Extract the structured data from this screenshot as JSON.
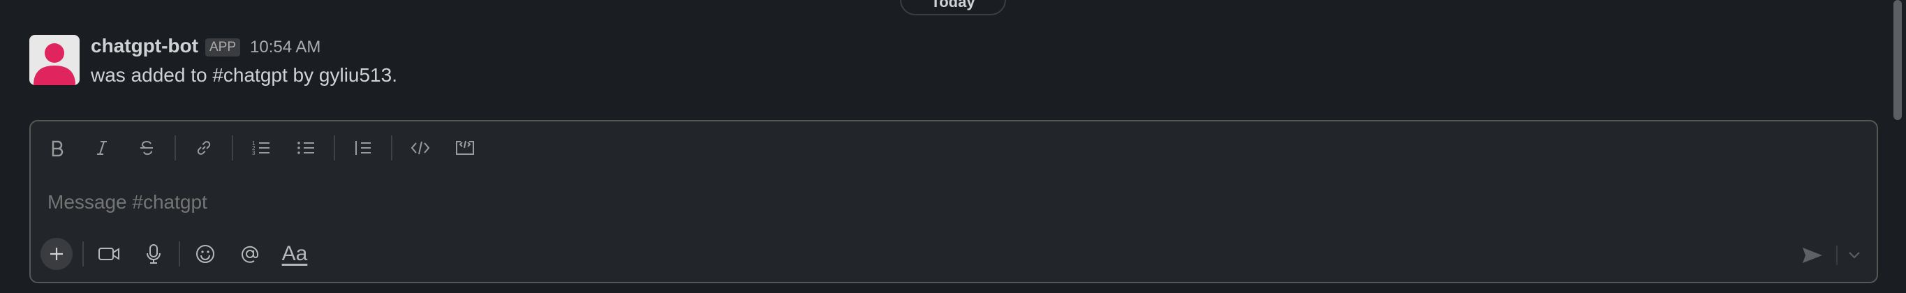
{
  "divider": {
    "label": "Today"
  },
  "message": {
    "author": "chatgpt-bot",
    "badge": "APP",
    "time": "10:54 AM",
    "text": "was added to #chatgpt by gyliu513."
  },
  "composer": {
    "placeholder": "Message #chatgpt",
    "toolbar": [
      "bold-icon",
      "italic-icon",
      "strikethrough-icon",
      "link-icon",
      "ordered-list-icon",
      "bulleted-list-icon",
      "blockquote-icon",
      "code-icon",
      "code-block-icon"
    ],
    "bottom_actions": [
      "plus-icon",
      "video-icon",
      "microphone-icon",
      "emoji-icon",
      "mention-icon",
      "format-text-icon"
    ],
    "format_label": "Aa"
  },
  "colors": {
    "background": "#1a1d21",
    "composer_bg": "#222529",
    "avatar_accent": "#e0245e"
  }
}
